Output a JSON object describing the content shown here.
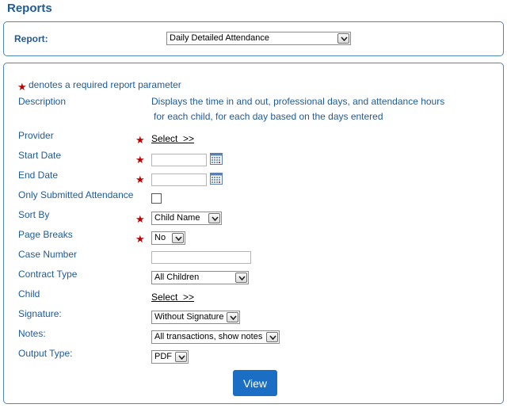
{
  "page_title": "Reports",
  "report_selector": {
    "label": "Report:",
    "selected": "Daily Detailed Attendance"
  },
  "legend": {
    "text": "denotes a required report parameter"
  },
  "description": {
    "label": "Description",
    "line1": "Displays the time in and out, professional days, and attendance hours",
    "line2": "for each child, for each day based on the days entered"
  },
  "fields": {
    "provider": {
      "label": "Provider",
      "link": "Select  >>"
    },
    "start_date": {
      "label": "Start Date",
      "value": ""
    },
    "end_date": {
      "label": "End Date",
      "value": ""
    },
    "only_submitted": {
      "label": "Only Submitted Attendance",
      "checked": false
    },
    "sort_by": {
      "label": "Sort By",
      "selected": "Child Name"
    },
    "page_breaks": {
      "label": "Page Breaks",
      "selected": "No"
    },
    "case_number": {
      "label": "Case Number",
      "value": ""
    },
    "contract_type": {
      "label": "Contract Type",
      "selected": "All Children"
    },
    "child": {
      "label": "Child",
      "link": "Select  >>"
    },
    "signature": {
      "label": "Signature:",
      "selected": "Without Signature"
    },
    "notes": {
      "label": "Notes:",
      "selected": "All transactions, show notes"
    },
    "output_type": {
      "label": "Output Type:",
      "selected": "PDF"
    }
  },
  "view_button": {
    "label": "View"
  },
  "colors": {
    "label_text": "#1f5a99",
    "required_star": "#c00000",
    "panel_border": "#4f86bd",
    "button_bg": "#1a6fc4"
  },
  "icons": {
    "required": "red-star-icon",
    "calendar": "calendar-icon",
    "dropdown": "chevron-down-icon"
  }
}
